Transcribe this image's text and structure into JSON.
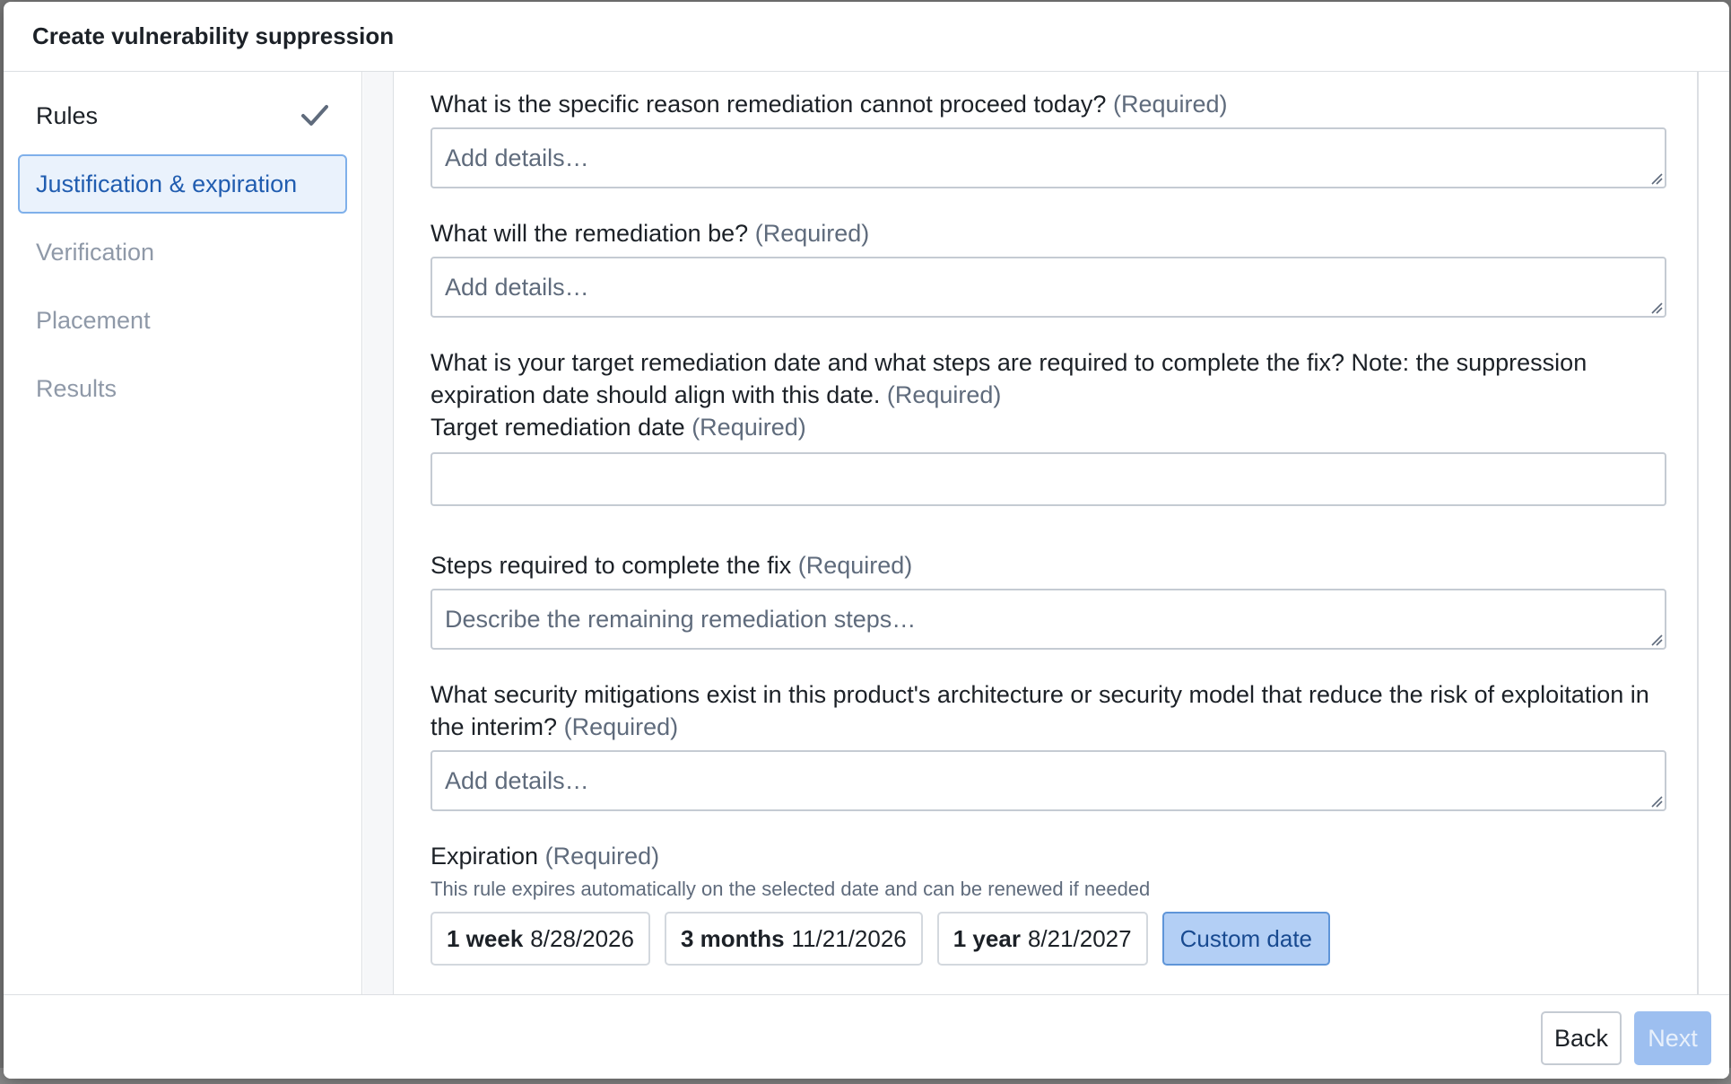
{
  "dialog": {
    "title": "Create vulnerability suppression"
  },
  "steps": [
    {
      "label": "Rules",
      "state": "done"
    },
    {
      "label": "Justification & expiration",
      "state": "active"
    },
    {
      "label": "Verification",
      "state": "pending"
    },
    {
      "label": "Placement",
      "state": "pending"
    },
    {
      "label": "Results",
      "state": "pending"
    }
  ],
  "form": {
    "required_tag": "(Required)",
    "q_reason": {
      "label": "What is the specific reason remediation cannot proceed today?",
      "placeholder": "Add details…"
    },
    "q_remediation": {
      "label": "What will the remediation be?",
      "placeholder": "Add details…"
    },
    "q_target": {
      "label": "What is your target remediation date and what steps are required to complete the fix? Note: the suppression expiration date should align with this date."
    },
    "target_date": {
      "label": "Target remediation date",
      "value": ""
    },
    "steps_required": {
      "label": "Steps required to complete the fix",
      "placeholder": "Describe the remaining remediation steps…"
    },
    "q_mitigations": {
      "label": "What security mitigations exist in this product's architecture or security model that reduce the risk of exploitation in the interim?",
      "placeholder": "Add details…"
    },
    "expiration": {
      "label": "Expiration",
      "helper": "This rule expires automatically on the selected date and can be renewed if needed",
      "options": [
        {
          "duration": "1 week",
          "date": "8/28/2026"
        },
        {
          "duration": "3 months",
          "date": "11/21/2026"
        },
        {
          "duration": "1 year",
          "date": "8/21/2027"
        }
      ],
      "custom_label": "Custom date",
      "selected": "Custom date"
    }
  },
  "footer": {
    "back_label": "Back",
    "next_label": "Next"
  },
  "colors": {
    "accent": "#215db0",
    "selected_bg": "#b3cff5",
    "next_disabled_bg": "#9dbff0"
  }
}
